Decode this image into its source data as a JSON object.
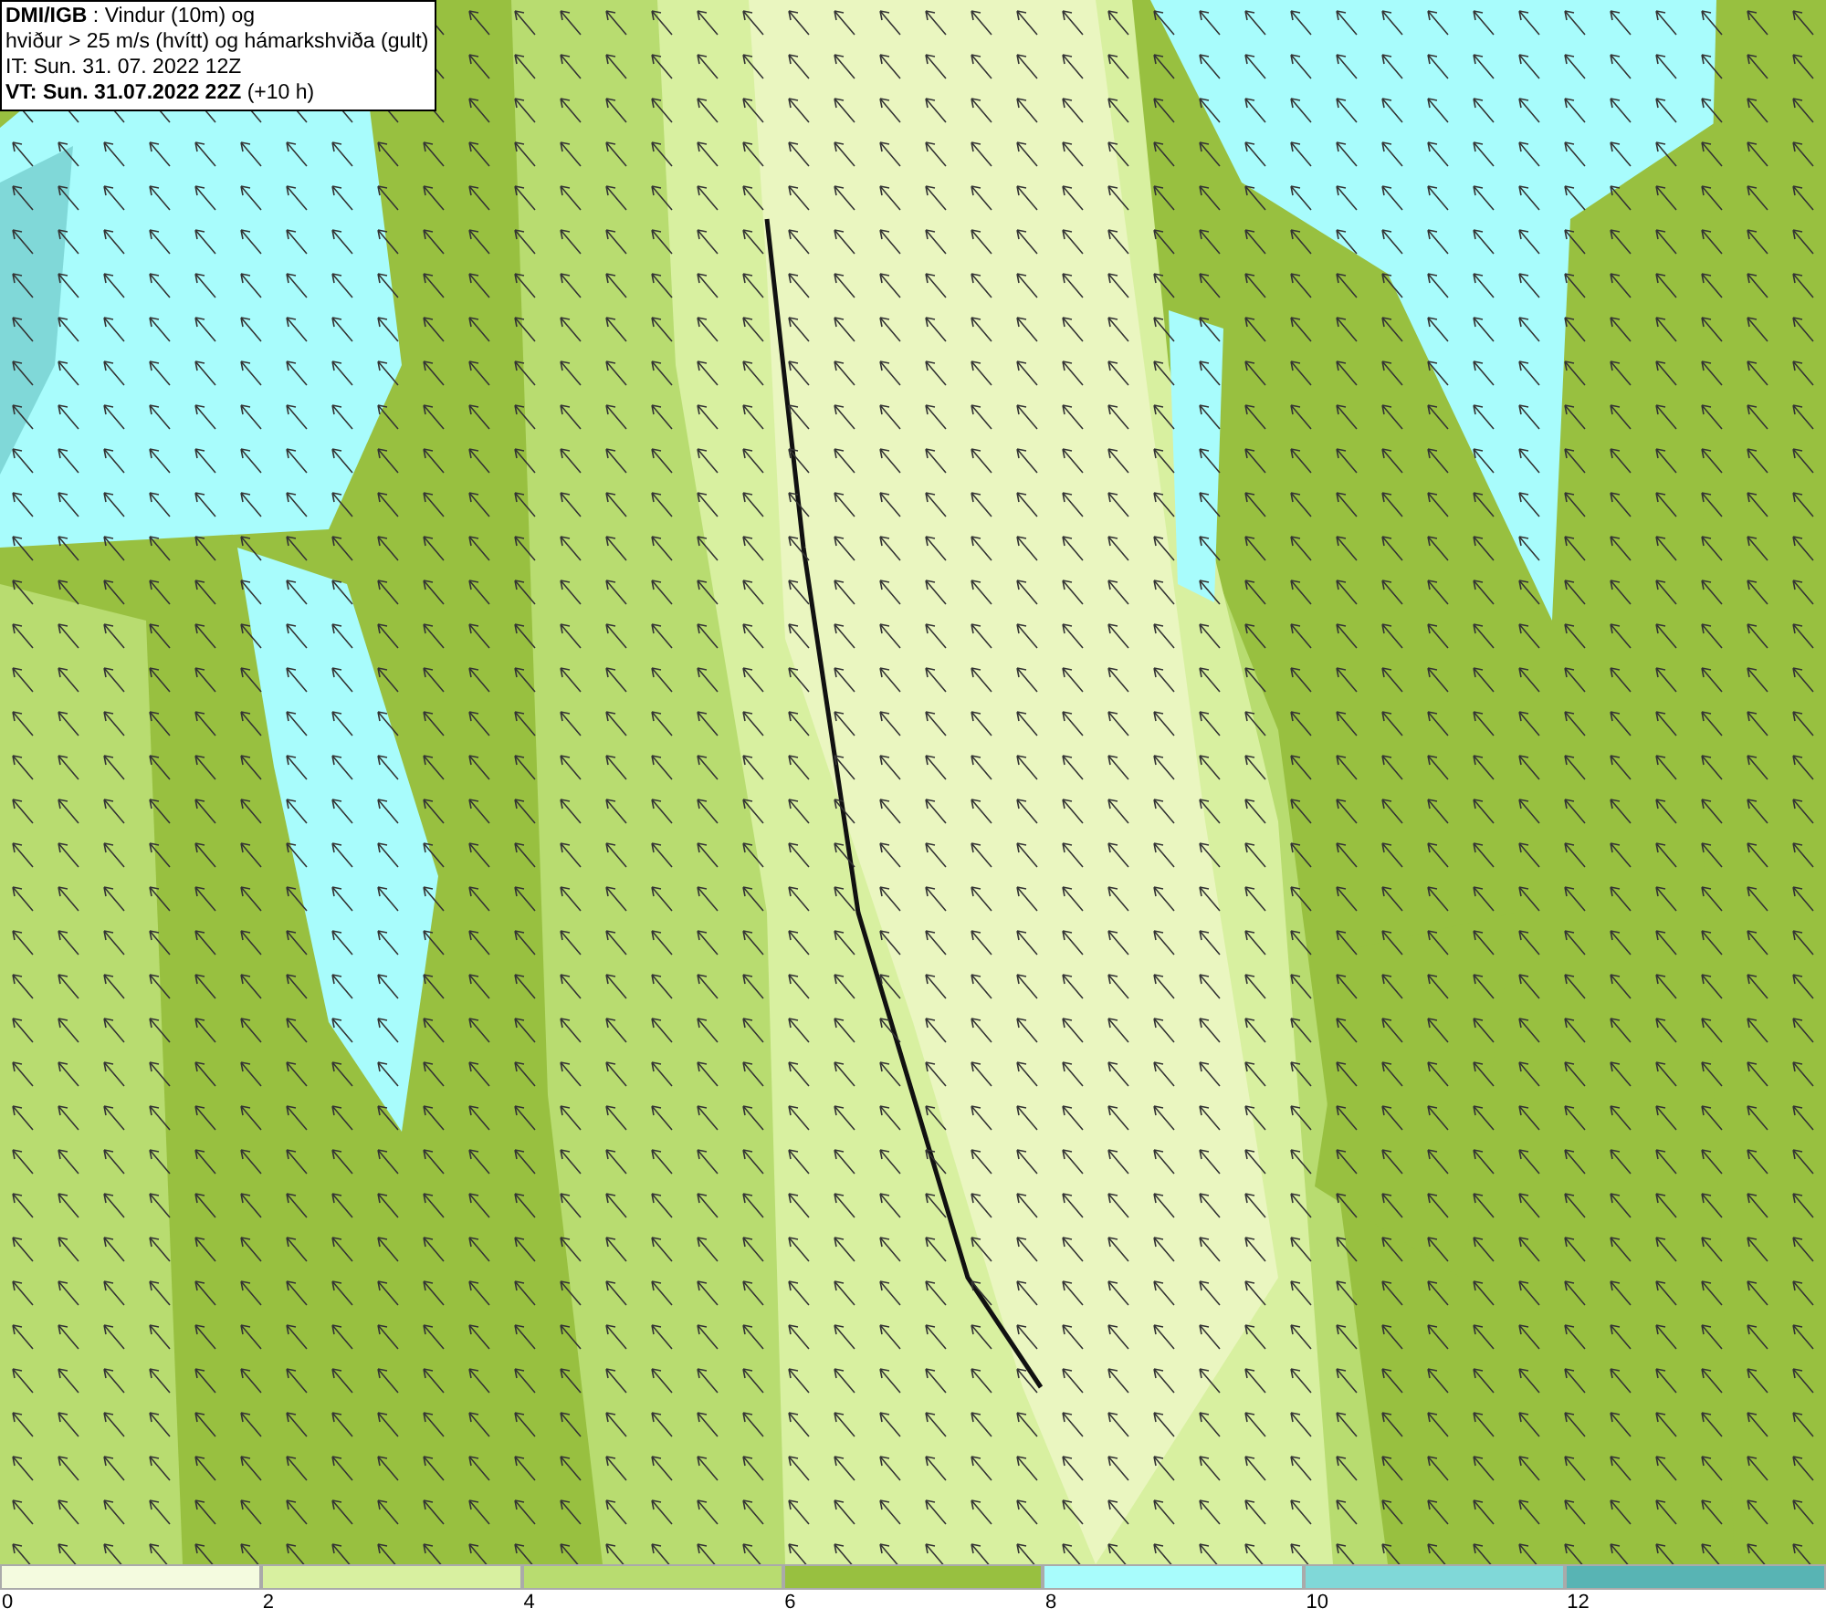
{
  "header": {
    "lines": [
      "**DMI/IGB** : Vindur (10m) og",
      "hviður > 25 m/s (hvítt) og hámarkshviða (gult)",
      "IT: Sun. 31. 07. 2022 12Z",
      "**VT: Sun. 31.07.2022 22Z** (+10 h)"
    ]
  },
  "legend": {
    "items": [
      {
        "label": "0",
        "color": "#f4fbdf"
      },
      {
        "label": "2",
        "color": "#d8f0a0"
      },
      {
        "label": "4",
        "color": "#b8dc70"
      },
      {
        "label": "6",
        "color": "#98c040"
      },
      {
        "label": "8",
        "color": "#a8fcfc"
      },
      {
        "label": "10",
        "color": "#80d8d8"
      },
      {
        "label": "12",
        "color": "#58b4b4"
      }
    ]
  }
}
